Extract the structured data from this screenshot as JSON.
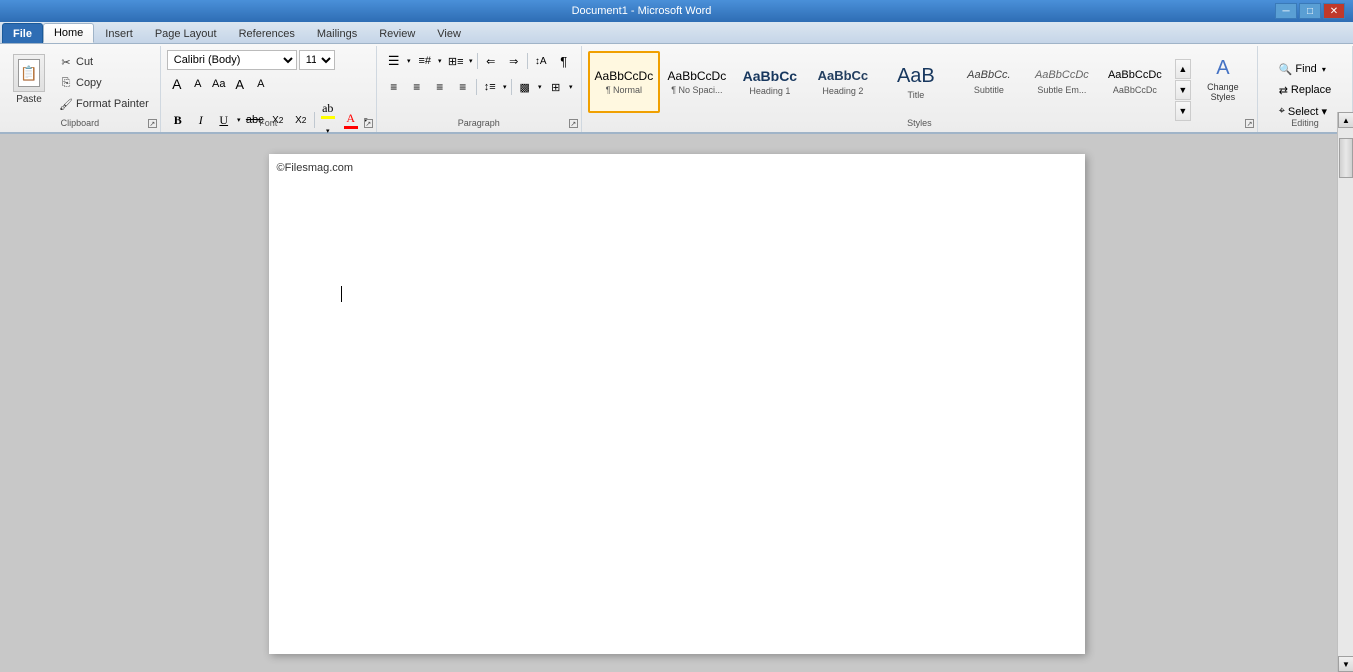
{
  "titleBar": {
    "title": "Document1 - Microsoft Word",
    "minimizeLabel": "─",
    "maximizeLabel": "□",
    "closeLabel": "✕"
  },
  "tabs": [
    {
      "label": "File",
      "active": false,
      "isFile": true
    },
    {
      "label": "Home",
      "active": true
    },
    {
      "label": "Insert",
      "active": false
    },
    {
      "label": "Page Layout",
      "active": false
    },
    {
      "label": "References",
      "active": false
    },
    {
      "label": "Mailings",
      "active": false
    },
    {
      "label": "Review",
      "active": false
    },
    {
      "label": "View",
      "active": false
    }
  ],
  "clipboard": {
    "groupLabel": "Clipboard",
    "pasteLabel": "Paste",
    "cutLabel": "Cut",
    "copyLabel": "Copy",
    "formatPainterLabel": "Format Painter"
  },
  "font": {
    "groupLabel": "Font",
    "fontName": "Calibri (Body)",
    "fontSize": "11",
    "boldLabel": "B",
    "italicLabel": "I",
    "underlineLabel": "U",
    "strikeLabel": "abc",
    "subscriptLabel": "X₂",
    "superscriptLabel": "X²",
    "growLabel": "A",
    "shrinkLabel": "A",
    "caseLabel": "Aa",
    "clearLabel": "A"
  },
  "paragraph": {
    "groupLabel": "Paragraph",
    "bullets": "≡",
    "numbered": "≡",
    "multilevel": "≡",
    "decreaseIndent": "⇐",
    "increaseIndent": "⇒",
    "sort": "↕A",
    "showHide": "¶",
    "alignLeft": "≡",
    "alignCenter": "≡",
    "alignRight": "≡",
    "justify": "≡",
    "lineSpacing": "↕",
    "shading": "▩",
    "borders": "⊞"
  },
  "styles": {
    "groupLabel": "Styles",
    "items": [
      {
        "preview": "AaBbCcDc",
        "label": "¶ Normal",
        "active": true,
        "style": "normal",
        "color": "#000"
      },
      {
        "preview": "AaBbCcDc",
        "label": "¶ No Spaci...",
        "active": false,
        "style": "no-spacing",
        "color": "#000"
      },
      {
        "preview": "AaBbCc",
        "label": "Heading 1",
        "active": false,
        "style": "heading1",
        "color": "#17375e"
      },
      {
        "preview": "AaBbCc",
        "label": "Heading 2",
        "active": false,
        "style": "heading2",
        "color": "#243f60"
      },
      {
        "preview": "AaB",
        "label": "Title",
        "active": false,
        "style": "title",
        "color": "#17375e"
      },
      {
        "preview": "AaBbCc.",
        "label": "Subtitle",
        "active": false,
        "style": "subtitle",
        "color": "#404040"
      },
      {
        "preview": "AaBbCcDc",
        "label": "Subtle Em...",
        "active": false,
        "style": "subtle",
        "color": "#666"
      },
      {
        "preview": "AaBbCcDc",
        "label": "AaBbCcDc",
        "active": false,
        "style": "emphasis",
        "color": "#000"
      }
    ],
    "changeStylesLabel": "Change\nStyles",
    "scrollUp": "▲",
    "scrollDown": "▼",
    "moreLabel": "▼"
  },
  "editing": {
    "groupLabel": "Editing",
    "findLabel": "Find",
    "replaceLabel": "Replace",
    "selectLabel": "Select ▾"
  },
  "document": {
    "watermark": "©Filesmag.com",
    "content": ""
  }
}
